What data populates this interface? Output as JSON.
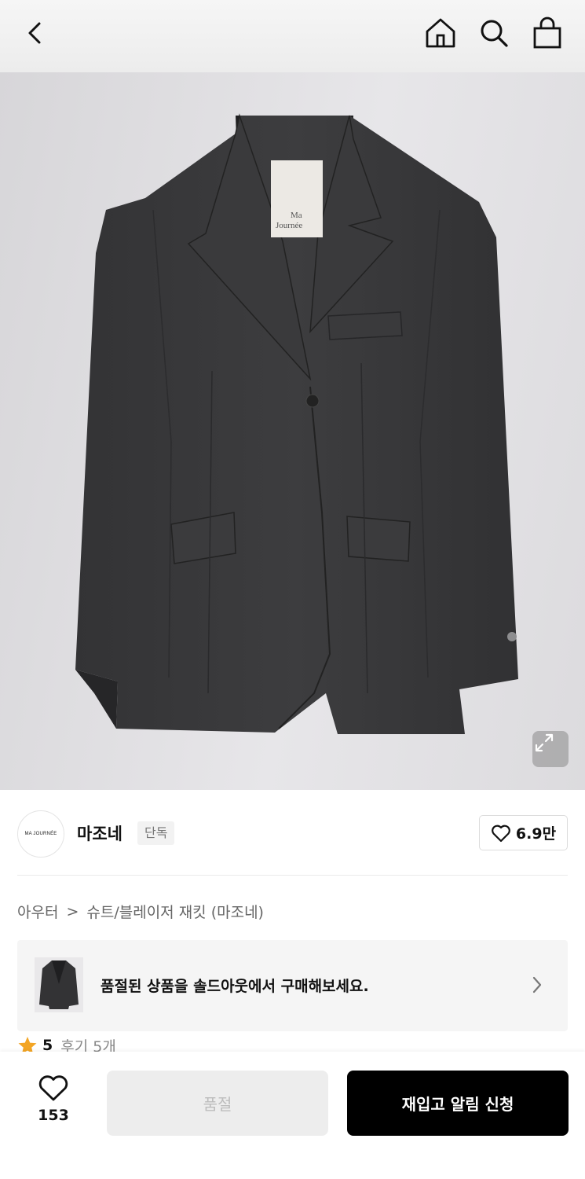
{
  "header": {
    "back_icon": "chevron-left-icon",
    "home_icon": "home-icon",
    "search_icon": "search-icon",
    "bag_icon": "shopping-bag-icon"
  },
  "product_image": {
    "tag_line1": "Ma",
    "tag_line2": "Journée",
    "expand_icon": "expand-icon"
  },
  "brand": {
    "logo_text": "MA JOURNÉE",
    "name": "마조네",
    "badge": "단독",
    "like_count": "6.9만"
  },
  "breadcrumb": {
    "category": "아우터",
    "separator": ">",
    "subcategory": "슈트/블레이저 재킷 (마조네)"
  },
  "soldout_banner": {
    "text": "품절된 상품을 솔드아웃에서 구매해보세요."
  },
  "rating": {
    "score": "5",
    "review_label": "후기 5개"
  },
  "bottom_bar": {
    "wish_count": "153",
    "soldout_label": "품절",
    "restock_label": "재입고 알림 신청"
  },
  "colors": {
    "primary_button": "#000000",
    "disabled_button": "#ededed",
    "star": "#f3a524"
  }
}
